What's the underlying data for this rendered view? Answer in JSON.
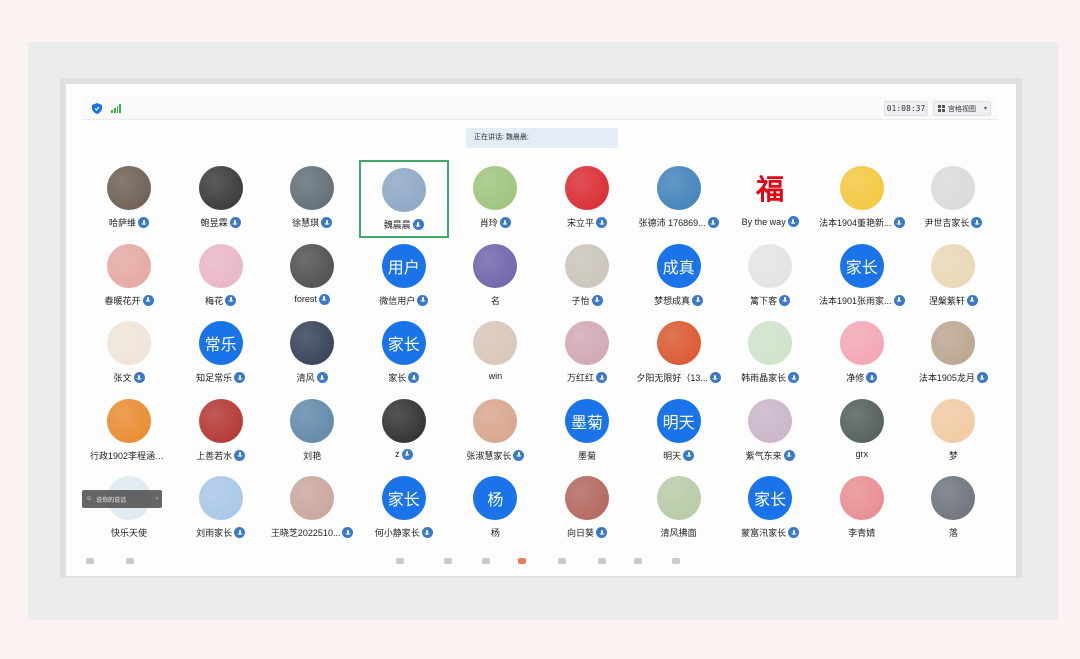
{
  "topbar": {
    "timer": "01:08:37",
    "view_label": "宫格视图"
  },
  "speaking": {
    "label": "正在讲话: 魏晨晨;"
  },
  "participants": [
    {
      "name": "哈萨维",
      "avatar": "photo",
      "color": "#6b5a4e",
      "mic": true
    },
    {
      "name": "鲍昱霖",
      "avatar": "photo",
      "color": "#333333",
      "mic": true
    },
    {
      "name": "徐慧琪",
      "avatar": "photo",
      "color": "#5c6a73",
      "mic": true
    },
    {
      "name": "魏晨晨",
      "avatar": "photo",
      "color": "#8aa5c4",
      "mic": true,
      "active": true
    },
    {
      "name": "肖玲",
      "avatar": "photo",
      "color": "#9bc27a",
      "mic": true
    },
    {
      "name": "宋立平",
      "avatar": "photo",
      "color": "#d8262c",
      "mic": true
    },
    {
      "name": "张德沛 176869...",
      "avatar": "photo",
      "color": "#3d7fb8",
      "mic": true
    },
    {
      "name": "By the way",
      "avatar": "photo",
      "color": "#e60012",
      "mic": true,
      "glyph": "福"
    },
    {
      "name": "法本1904董艳新...",
      "avatar": "photo",
      "color": "#f3c73a",
      "mic": true
    },
    {
      "name": "尹世吉家长",
      "avatar": "photo",
      "color": "#d9d9d9",
      "mic": true
    },
    {
      "name": "春暖花开",
      "avatar": "photo",
      "color": "#e4a6a0",
      "mic": true
    },
    {
      "name": "梅花",
      "avatar": "photo",
      "color": "#e9b4c4",
      "mic": true
    },
    {
      "name": "forest",
      "avatar": "photo",
      "color": "#4a4a4a",
      "mic": true
    },
    {
      "name": "微信用户",
      "avatar": "text",
      "text": "用户",
      "mic": true
    },
    {
      "name": "名",
      "avatar": "photo",
      "color": "#6d5fa8",
      "mic": false
    },
    {
      "name": "子怡",
      "avatar": "photo",
      "color": "#c9c3b8",
      "mic": true
    },
    {
      "name": "梦想成真",
      "avatar": "text",
      "text": "成真",
      "mic": true
    },
    {
      "name": "篱下客",
      "avatar": "photo",
      "color": "#e3e3e3",
      "mic": true
    },
    {
      "name": "法本1901张雨家...",
      "avatar": "text",
      "text": "家长",
      "mic": true
    },
    {
      "name": "涅槃紫轩",
      "avatar": "photo",
      "color": "#e8d7b5",
      "mic": true
    },
    {
      "name": "张文",
      "avatar": "photo",
      "color": "#efe4d6",
      "mic": true
    },
    {
      "name": "知足常乐",
      "avatar": "text",
      "text": "常乐",
      "mic": true
    },
    {
      "name": "清风",
      "avatar": "photo",
      "color": "#2f3c52",
      "mic": true
    },
    {
      "name": "家长",
      "avatar": "text",
      "text": "家长",
      "mic": true
    },
    {
      "name": "win",
      "avatar": "photo",
      "color": "#d7c4b6",
      "mic": false
    },
    {
      "name": "万红红",
      "avatar": "photo",
      "color": "#cfa6b0",
      "mic": true
    },
    {
      "name": "夕阳无限好（13...",
      "avatar": "photo",
      "color": "#d9532b",
      "mic": true
    },
    {
      "name": "韩雨晶家长",
      "avatar": "photo",
      "color": "#cde2c7",
      "mic": true
    },
    {
      "name": "净修",
      "avatar": "photo",
      "color": "#f2a3b3",
      "mic": true
    },
    {
      "name": "法本1905龙月",
      "avatar": "photo",
      "color": "#b9a38c",
      "mic": true
    },
    {
      "name": "行政1902李程涵家长",
      "avatar": "photo",
      "color": "#e8882a",
      "mic": false
    },
    {
      "name": "上善若水",
      "avatar": "photo",
      "color": "#b1312c",
      "mic": true
    },
    {
      "name": "刘艳",
      "avatar": "photo",
      "color": "#5d86a8",
      "mic": false
    },
    {
      "name": "z",
      "avatar": "photo",
      "color": "#2b2b2b",
      "mic": true
    },
    {
      "name": "张淑慧家长",
      "avatar": "photo",
      "color": "#d7a28a",
      "mic": true
    },
    {
      "name": "墨菊",
      "avatar": "text",
      "text": "墨菊",
      "mic": false
    },
    {
      "name": "明天",
      "avatar": "text",
      "text": "明天",
      "mic": true
    },
    {
      "name": "紫气东来",
      "avatar": "photo",
      "color": "#c9b2c8",
      "mic": true
    },
    {
      "name": "grx",
      "avatar": "photo",
      "color": "#4d5a56",
      "mic": false
    },
    {
      "name": "梦",
      "avatar": "photo",
      "color": "#f1c9a0",
      "mic": false
    },
    {
      "name": "快乐天使",
      "avatar": "photo",
      "color": "#dfe9ef",
      "mic": false
    },
    {
      "name": "刘雨家长",
      "avatar": "photo",
      "color": "#a7c5e6",
      "mic": true
    },
    {
      "name": "王晓芝2022510...",
      "avatar": "photo",
      "color": "#c7a49a",
      "mic": true
    },
    {
      "name": "何小静家长",
      "avatar": "text",
      "text": "家长",
      "mic": true
    },
    {
      "name": "杨",
      "avatar": "text",
      "text": "杨",
      "mic": false
    },
    {
      "name": "向日葵",
      "avatar": "photo",
      "color": "#b0635a",
      "mic": true
    },
    {
      "name": "清风拂面",
      "avatar": "photo",
      "color": "#b6c9a3",
      "mic": false
    },
    {
      "name": "蒙富汛家长",
      "avatar": "text",
      "text": "家长",
      "mic": true
    },
    {
      "name": "李青婧",
      "avatar": "photo",
      "color": "#e88a8f",
      "mic": false
    },
    {
      "name": "落",
      "avatar": "photo",
      "color": "#6a6f78",
      "mic": false
    }
  ],
  "tooltip": {
    "text": "说你的说话"
  },
  "icons": {
    "shield": "shield-icon",
    "signal": "signal-icon",
    "grid_view": "grid-view-icon",
    "mic": "mic-icon"
  },
  "colors": {
    "active_border": "#3daa6b",
    "text_avatar": "#1a73e8",
    "mic_badge": "#3a79c8"
  }
}
